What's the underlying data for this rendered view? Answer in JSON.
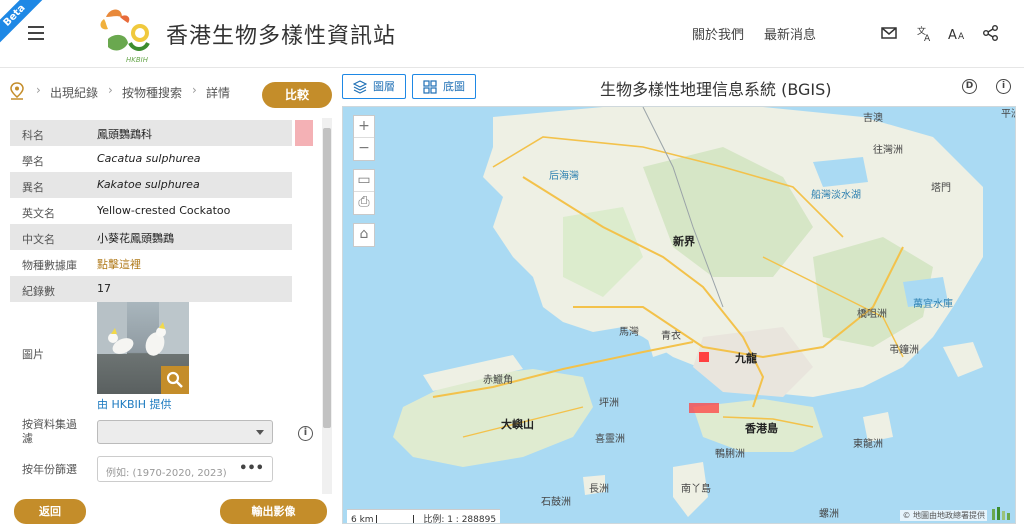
{
  "header": {
    "beta": "Beta",
    "title": "香港生物多樣性資訊站",
    "logo_text": "HKBIH",
    "nav": [
      "關於我們",
      "最新消息"
    ],
    "icons": [
      "mail-icon",
      "translate-icon",
      "font-size-icon",
      "share-icon"
    ]
  },
  "breadcrumb": {
    "items": [
      "出現紀錄",
      "按物種搜索",
      "詳情"
    ],
    "compare_label": "比較"
  },
  "details": {
    "rows": [
      {
        "label": "科名",
        "value": "鳳頭鸚鵡科"
      },
      {
        "label": "學名",
        "value": "Cacatua sulphurea"
      },
      {
        "label": "異名",
        "value": "Kakatoe sulphurea"
      },
      {
        "label": "英文名",
        "value": "Yellow-crested Cockatoo"
      },
      {
        "label": "中文名",
        "value": "小葵花鳳頭鸚鵡"
      },
      {
        "label": "物種數據庫",
        "value": "點擊這裡"
      },
      {
        "label": "紀錄數",
        "value": "17"
      }
    ],
    "photo_label": "圖片",
    "photo_credit": "由 HKBIH 提供",
    "dataset_filter_label": "按資料集過濾",
    "year_filter_label": "按年份篩選",
    "year_placeholder": "例如: (1970-2020, 2023)",
    "year_menu": "•••",
    "swatch_color": "#f4b1b5"
  },
  "buttons": {
    "back": "返回",
    "export": "輸出影像"
  },
  "map": {
    "layers_label": "圖層",
    "basemap_label": "底圖",
    "title": "生物多樣性地理信息系統 (BGIS)",
    "controls": [
      "+",
      "−"
    ],
    "places": [
      {
        "name": "吉澳",
        "style": "normal"
      },
      {
        "name": "平洲",
        "style": "normal"
      },
      {
        "name": "往灣洲",
        "style": "normal"
      },
      {
        "name": "后海灣",
        "style": "blue"
      },
      {
        "name": "船灣淡水湖",
        "style": "blue"
      },
      {
        "name": "塔門",
        "style": "normal"
      },
      {
        "name": "新界",
        "style": "big"
      },
      {
        "name": "萬宜水庫",
        "style": "blue"
      },
      {
        "name": "橋咀洲",
        "style": "normal"
      },
      {
        "name": "馬灣",
        "style": "normal"
      },
      {
        "name": "青衣",
        "style": "normal"
      },
      {
        "name": "九龍",
        "style": "big"
      },
      {
        "name": "弔鐘洲",
        "style": "normal"
      },
      {
        "name": "赤鱲角",
        "style": "normal"
      },
      {
        "name": "坪洲",
        "style": "normal"
      },
      {
        "name": "大嶼山",
        "style": "big"
      },
      {
        "name": "喜靈洲",
        "style": "normal"
      },
      {
        "name": "香港島",
        "style": "big"
      },
      {
        "name": "鴨脷洲",
        "style": "normal"
      },
      {
        "name": "東龍洲",
        "style": "normal"
      },
      {
        "name": "長洲",
        "style": "normal"
      },
      {
        "name": "石鼓洲",
        "style": "normal"
      },
      {
        "name": "南丫島",
        "style": "normal"
      },
      {
        "name": "螺洲",
        "style": "normal"
      }
    ],
    "scale_text": "6 km",
    "ratio_text": "比例: 1 : 288895",
    "attribution": "© 地圖由地政總署提供"
  }
}
